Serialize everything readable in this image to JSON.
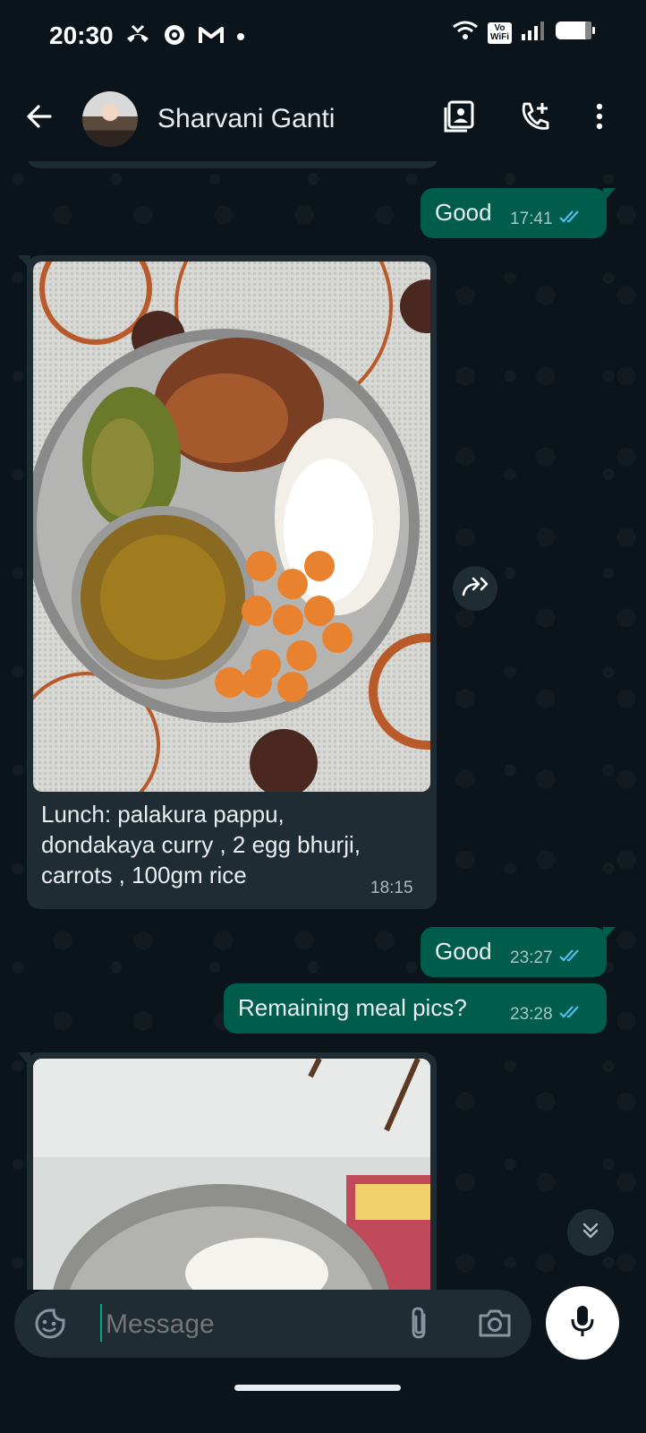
{
  "status_bar": {
    "time": "20:30",
    "left_icons": [
      "missed-call-icon",
      "vpn-icon",
      "gmail-icon",
      "dot-icon"
    ],
    "vowifi_label_top": "Vo",
    "vowifi_label_bottom": "WiFi",
    "right_icons": [
      "wifi-icon",
      "vowifi-icon",
      "signal-icon",
      "battery-icon"
    ]
  },
  "header": {
    "contact_name": "Sharvani Ganti",
    "icons": [
      "back-arrow-icon",
      "contact-card-icon",
      "add-call-icon",
      "more-vert-icon"
    ]
  },
  "messages": [
    {
      "direction": "out",
      "text": "Good",
      "time": "17:41",
      "read": true
    },
    {
      "direction": "in",
      "type": "image",
      "caption": "Lunch: palakura pappu,\ndondakaya curry , 2 egg bhurji,\ncarrots , 100gm rice",
      "time": "18:15"
    },
    {
      "direction": "out",
      "text": "Good",
      "time": "23:27",
      "read": true
    },
    {
      "direction": "out",
      "text": "Remaining meal pics?",
      "time": "23:28",
      "read": true
    },
    {
      "direction": "in",
      "type": "image",
      "caption": "",
      "time": ""
    }
  ],
  "input": {
    "placeholder": "Message",
    "icons": [
      "sticker-icon",
      "attach-icon",
      "camera-icon",
      "mic-icon"
    ]
  },
  "colors": {
    "background": "#0b141a",
    "outgoing_bubble": "#005c4b",
    "incoming_bubble": "#1f2c34",
    "read_tick": "#53bdeb",
    "accent": "#00a884"
  }
}
